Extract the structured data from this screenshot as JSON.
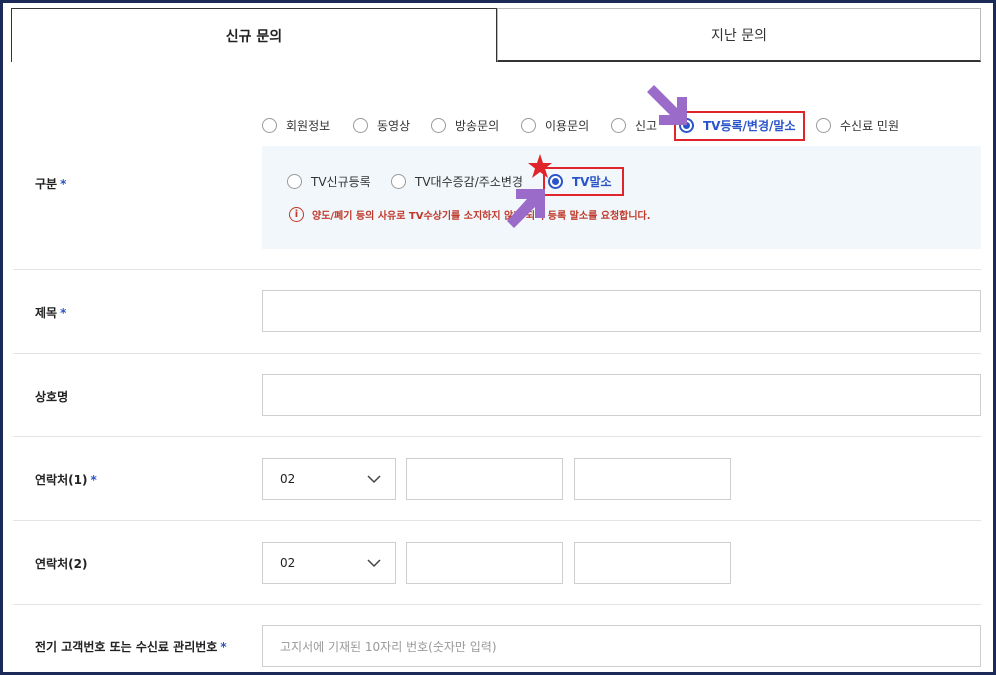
{
  "tabs": {
    "new_inquiry": "신규 문의",
    "past_inquiry": "지난 문의"
  },
  "category": {
    "label": "구분",
    "required_mark": "*",
    "options": [
      "회원정보",
      "동영상",
      "방송문의",
      "이용문의",
      "신고",
      "TV등록/변경/말소",
      "수신료 민원"
    ],
    "selected": "TV등록/변경/말소",
    "sub_options": [
      "TV신규등록",
      "TV대수증감/주소변경",
      "TV말소"
    ],
    "sub_selected": "TV말소",
    "notice_icon": "info-icon",
    "notice": "양도/폐기 등의 사유로 TV수상기를 소지하지 않게 되어 등록 말소를 요청합니다."
  },
  "fields": {
    "title_label": "제목",
    "business_name_label": "상호명",
    "contact1_label": "연락처(1)",
    "contact2_label": "연락처(2)",
    "contact1_prefix": "02",
    "contact2_prefix": "02",
    "customer_no_label": "전기 고객번호 또는 수신료 관리번호",
    "customer_no_placeholder": "고지서에 기재된 10자리 번호(숫자만 입력)",
    "required_mark": "*"
  },
  "colors": {
    "accent": "#2a54c9",
    "highlight": "#e0242b",
    "arrow": "#9b6bc9",
    "notice": "#c0392b"
  }
}
